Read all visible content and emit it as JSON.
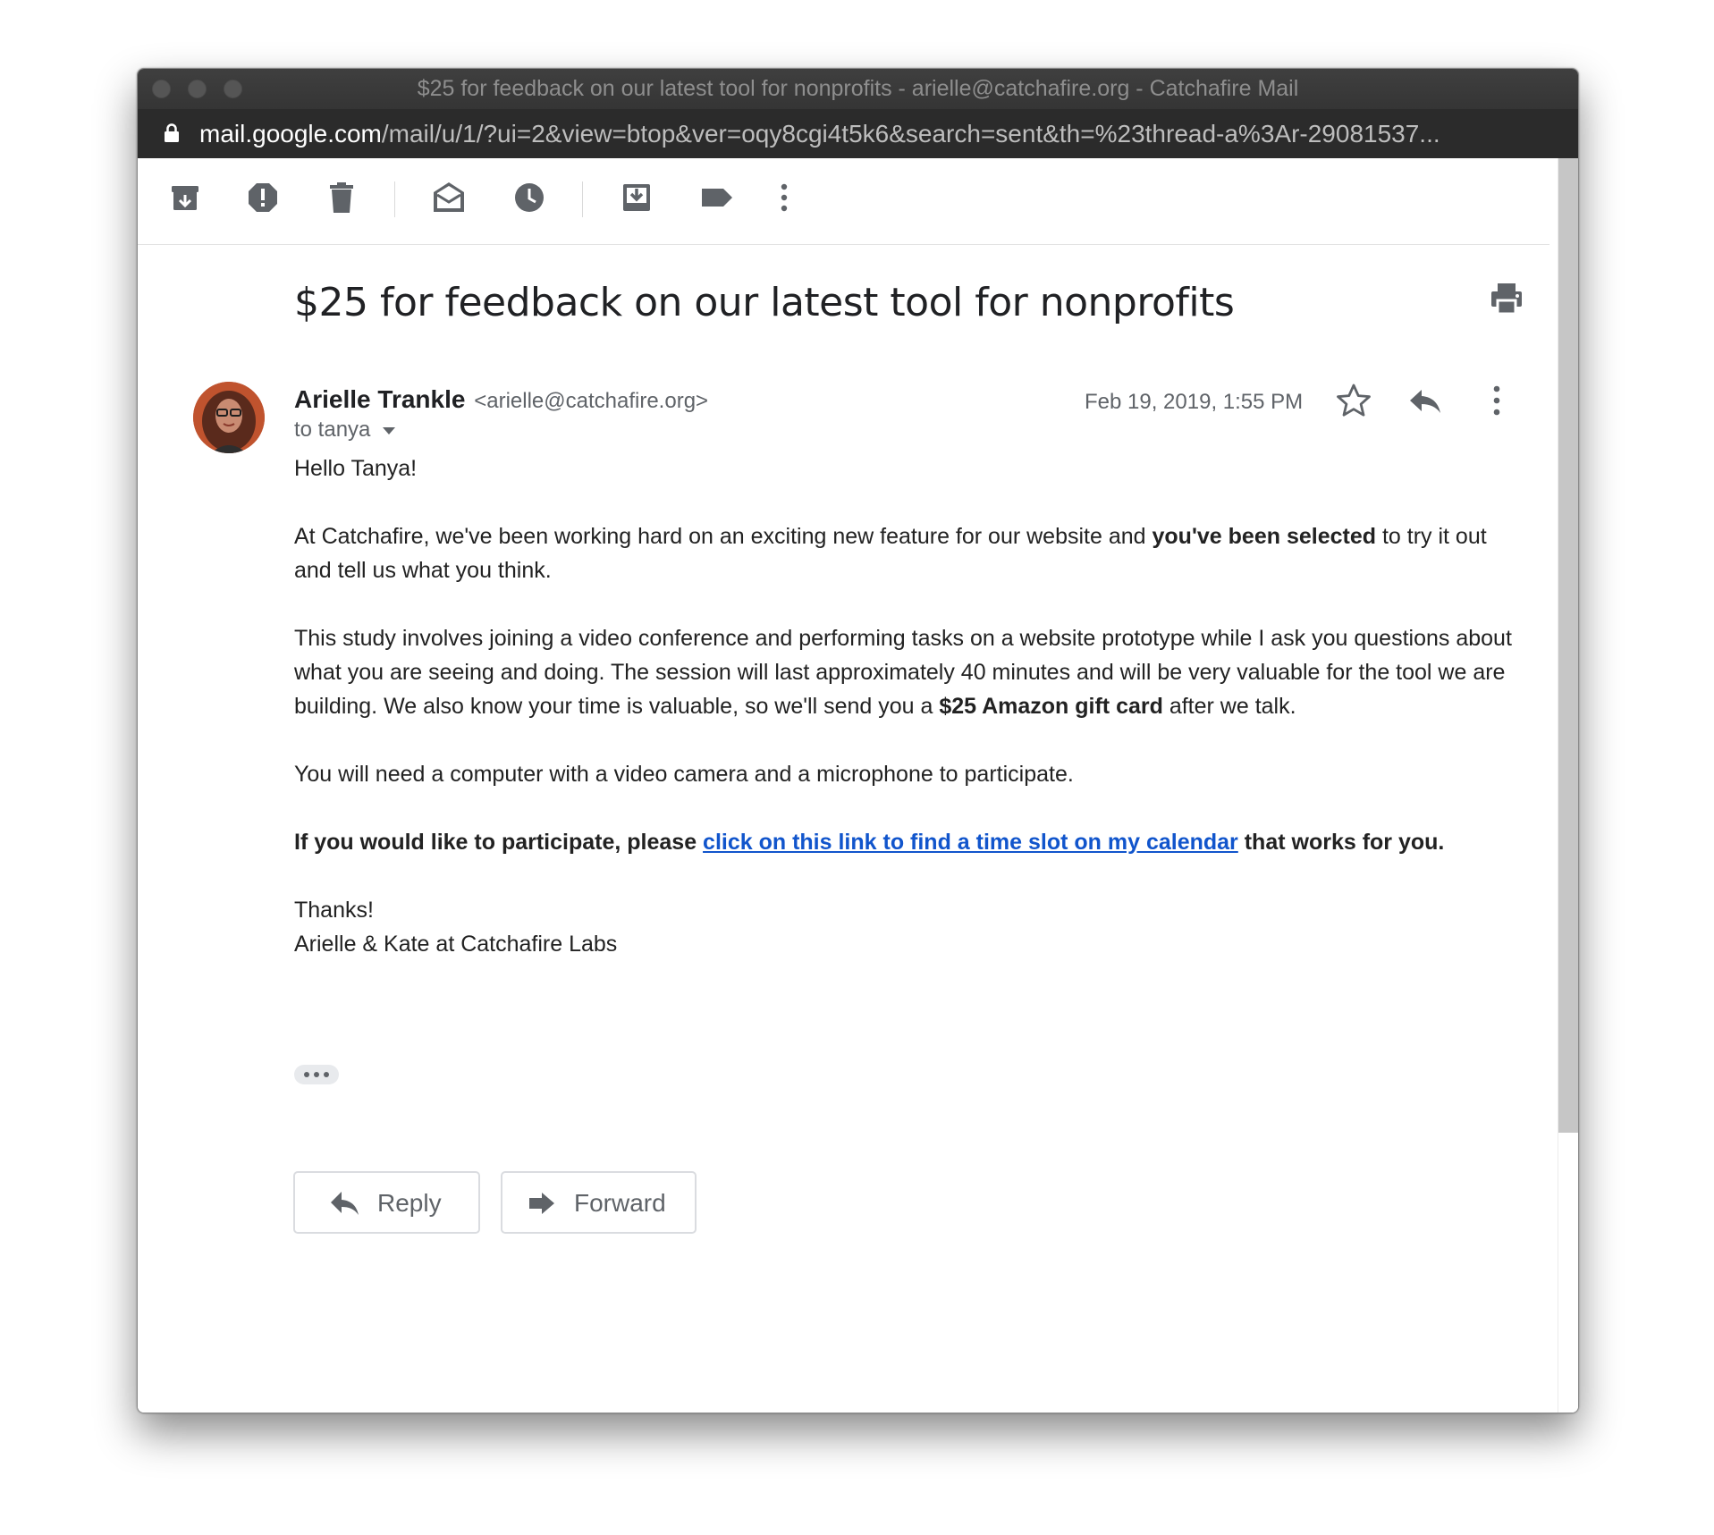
{
  "window": {
    "title": "$25 for feedback on our latest tool for nonprofits - arielle@catchafire.org - Catchafire Mail",
    "url_domain": "mail.google.com",
    "url_path": "/mail/u/1/?ui=2&view=btop&ver=oqy8cgi4t5k6&search=sent&th=%23thread-a%3Ar-29081537..."
  },
  "toolbar": {
    "icons": [
      "archive-icon",
      "report-spam-icon",
      "delete-icon",
      "mark-unread-icon",
      "snooze-icon",
      "move-to-icon",
      "label-icon",
      "more-icon"
    ]
  },
  "email": {
    "subject": "$25 for feedback on our latest tool for nonprofits",
    "sender_name": "Arielle Trankle",
    "sender_email": "<arielle@catchafire.org>",
    "recipient": "to tanya",
    "date": "Feb 19, 2019, 1:55 PM",
    "body": {
      "greeting": "Hello Tanya!",
      "p1_a": "At Catchafire, we've been working hard on an exciting new feature for our website and ",
      "p1_bold": "you've been selected",
      "p1_b": " to try it out and tell us what you think.",
      "p2_a": "This study involves joining a video conference and performing tasks on a website prototype while I ask you questions about what you are seeing and doing. The session will last approximately 40 minutes and will be very valuable for the tool we are building. We also know your time is valuable, so we'll send you a ",
      "p2_bold": "$25 Amazon gift card",
      "p2_b": " after we talk.",
      "p3": "You will need a computer with a video camera and a microphone to participate.",
      "p4_a": "If you would like to participate, please ",
      "p4_link": "click on this link to find a time slot on my calendar",
      "p4_b": " that works for you.",
      "sign_1": "Thanks!",
      "sign_2": "Arielle & Kate at Catchafire Labs"
    }
  },
  "actions": {
    "reply_label": "Reply",
    "forward_label": "Forward"
  },
  "colors": {
    "link": "#1155cc",
    "icon": "#5f6368",
    "titlebar": "#3a3a3a",
    "urlbar": "#2b2b2b"
  }
}
